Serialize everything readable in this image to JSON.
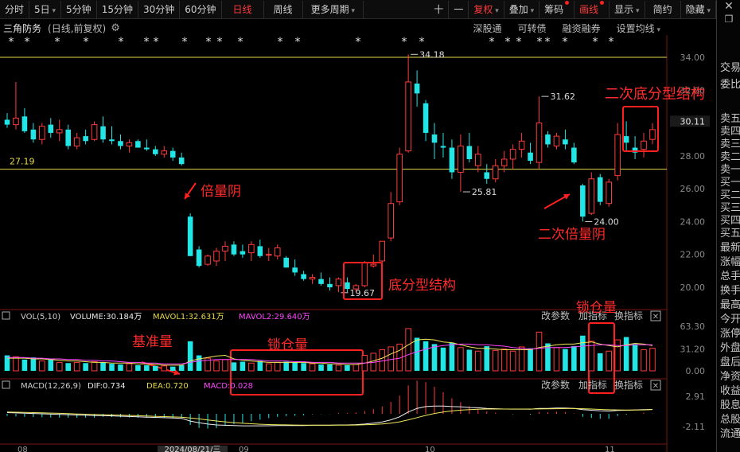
{
  "toolbar": {
    "periods": [
      "分时",
      "5日",
      "5分钟",
      "15分钟",
      "30分钟",
      "60分钟",
      "日线",
      "周线",
      "更多周期"
    ],
    "active_period": "日线",
    "right_items": [
      "十",
      "一",
      "复权",
      "叠加",
      "筹码",
      "画线",
      "显示",
      "简约",
      "隐藏"
    ]
  },
  "info": {
    "stock_name": "三角防务",
    "mode": "(日线,前复权)",
    "links": [
      "深股通",
      "可转债",
      "融资融券",
      "设置均线"
    ]
  },
  "price_axis": [
    "34.00",
    "32.00",
    "30.11",
    "28.00",
    "26.00",
    "24.00",
    "22.00",
    "20.00"
  ],
  "current_price": "30.11",
  "horizontal_lines": [
    {
      "value": 34.0,
      "color": "#e6d84a"
    },
    {
      "value": 27.19,
      "label": "27.19",
      "color": "#e6d84a"
    }
  ],
  "price_labels": [
    "34.18",
    "31.62",
    "25.81",
    "24.00",
    "19.67"
  ],
  "vol_panel": {
    "header": "VOL(5,10)",
    "volume": "VOLUME:30.184万",
    "mavol1": "MAVOL1:32.631万",
    "mavol2": "MAVOL2:29.640万",
    "axis": [
      "63.30",
      "31.20",
      "0.00"
    ],
    "buttons": [
      "改参数",
      "加指标",
      "换指标"
    ]
  },
  "macd_panel": {
    "header": "MACD(12,26,9)",
    "dif": "DIF:0.734",
    "dea": "DEA:0.720",
    "macd": "MACD:0.028",
    "axis": [
      "2.91",
      "-2.11"
    ],
    "buttons": [
      "改参数",
      "加指标",
      "换指标"
    ]
  },
  "date_axis": [
    "08",
    "2024/08/21/三",
    "09",
    "10",
    "11"
  ],
  "annotations": {
    "beiliangyin": "倍量阴",
    "difenxing": "底分型结构",
    "jizhunliang": "基准量",
    "suocangliang1": "锁仓量",
    "suocangliang2": "锁仓量",
    "erci_dif": "二次底分型结构",
    "erci_beiliang": "二次倍量阴"
  },
  "side_labels": [
    "交易",
    "委比",
    "卖五",
    "卖四",
    "卖三",
    "卖二",
    "卖一",
    "买一",
    "买二",
    "买三",
    "买四",
    "买五",
    "最新",
    "涨幅",
    "总手",
    "换手",
    "最高",
    "今开",
    "涨停",
    "外盘",
    "盘后",
    "净资",
    "收益",
    "股息",
    "总股",
    "流通"
  ],
  "chart_data": {
    "type": "candlestick",
    "ylim": [
      19.0,
      34.6
    ],
    "candles": [
      [
        30.2,
        30.6,
        29.7,
        29.9
      ],
      [
        29.9,
        32.5,
        29.6,
        30.3
      ],
      [
        30.4,
        30.9,
        29.4,
        29.5
      ],
      [
        29.6,
        30.0,
        28.8,
        29.0
      ],
      [
        29.0,
        30.0,
        28.7,
        29.8
      ],
      [
        29.9,
        30.3,
        29.1,
        29.4
      ],
      [
        29.4,
        30.2,
        28.9,
        29.6
      ],
      [
        29.6,
        29.9,
        28.4,
        28.6
      ],
      [
        28.6,
        29.4,
        28.4,
        29.1
      ],
      [
        29.2,
        29.6,
        28.7,
        28.9
      ],
      [
        29.0,
        30.1,
        28.9,
        29.9
      ],
      [
        29.8,
        30.4,
        28.8,
        29.0
      ],
      [
        29.0,
        29.8,
        28.7,
        28.9
      ],
      [
        28.9,
        29.3,
        28.4,
        28.6
      ],
      [
        28.6,
        29.0,
        28.2,
        28.8
      ],
      [
        28.9,
        29.0,
        28.5,
        28.5
      ],
      [
        28.5,
        29.0,
        28.3,
        28.4
      ],
      [
        28.4,
        28.6,
        28.0,
        28.1
      ],
      [
        28.1,
        28.6,
        27.9,
        28.3
      ],
      [
        28.3,
        28.5,
        27.7,
        27.9
      ],
      [
        27.9,
        28.2,
        27.4,
        27.5
      ],
      [
        24.3,
        24.5,
        21.9,
        21.9
      ],
      [
        22.3,
        22.5,
        21.2,
        21.3
      ],
      [
        21.4,
        22.0,
        21.3,
        21.9
      ],
      [
        21.6,
        22.4,
        21.3,
        22.2
      ],
      [
        22.2,
        22.8,
        21.6,
        22.5
      ],
      [
        22.6,
        22.8,
        21.9,
        22.0
      ],
      [
        22.2,
        22.6,
        21.8,
        22.0
      ],
      [
        22.1,
        22.8,
        21.6,
        22.6
      ],
      [
        22.5,
        22.9,
        21.8,
        21.9
      ],
      [
        22.0,
        22.4,
        21.6,
        22.0
      ],
      [
        21.9,
        22.6,
        21.7,
        22.4
      ],
      [
        21.8,
        21.9,
        21.2,
        21.2
      ],
      [
        21.2,
        21.7,
        20.7,
        20.9
      ],
      [
        20.8,
        21.0,
        20.4,
        20.5
      ],
      [
        20.5,
        20.8,
        20.2,
        20.6
      ],
      [
        20.5,
        20.9,
        20.1,
        20.2
      ],
      [
        20.2,
        20.6,
        19.8,
        20.0
      ],
      [
        20.1,
        20.6,
        19.7,
        20.5
      ],
      [
        20.3,
        20.6,
        19.7,
        19.9
      ],
      [
        19.9,
        20.2,
        19.7,
        20.1
      ],
      [
        20.1,
        21.6,
        20.0,
        21.5
      ],
      [
        21.3,
        22.0,
        21.2,
        21.4
      ],
      [
        21.6,
        22.8,
        21.4,
        22.8
      ],
      [
        23.0,
        25.8,
        22.8,
        25.1
      ],
      [
        25.2,
        28.5,
        25.0,
        28.1
      ],
      [
        28.3,
        34.18,
        28.2,
        32.5
      ],
      [
        32.4,
        33.2,
        31.0,
        31.8
      ],
      [
        31.2,
        31.4,
        28.9,
        29.4
      ],
      [
        29.3,
        30.0,
        27.8,
        28.8
      ],
      [
        28.6,
        29.4,
        27.9,
        28.5
      ],
      [
        28.5,
        29.0,
        26.6,
        27.0
      ],
      [
        27.0,
        29.3,
        25.81,
        28.6
      ],
      [
        28.6,
        29.4,
        27.6,
        27.8
      ],
      [
        27.4,
        28.6,
        27.0,
        28.1
      ],
      [
        27.0,
        27.5,
        26.3,
        26.6
      ],
      [
        26.6,
        27.8,
        26.4,
        27.4
      ],
      [
        27.4,
        28.3,
        27.0,
        27.8
      ],
      [
        27.8,
        28.7,
        27.2,
        28.4
      ],
      [
        28.4,
        29.4,
        27.9,
        28.9
      ],
      [
        28.2,
        28.8,
        27.5,
        27.7
      ],
      [
        27.6,
        31.62,
        27.2,
        30.0
      ],
      [
        29.3,
        29.5,
        28.5,
        28.7
      ],
      [
        28.6,
        29.4,
        28.4,
        29.2
      ],
      [
        29.0,
        29.6,
        28.4,
        28.7
      ],
      [
        28.5,
        28.8,
        27.5,
        27.6
      ],
      [
        26.2,
        26.3,
        24.0,
        24.3
      ],
      [
        24.5,
        27.0,
        24.4,
        26.6
      ],
      [
        26.7,
        26.9,
        25.0,
        25.2
      ],
      [
        25.1,
        26.6,
        24.9,
        26.4
      ],
      [
        26.8,
        30.0,
        26.5,
        29.3
      ],
      [
        29.2,
        30.1,
        28.3,
        28.8
      ],
      [
        28.5,
        29.2,
        27.8,
        28.2
      ],
      [
        28.4,
        29.4,
        27.9,
        28.9
      ],
      [
        29.0,
        30.0,
        28.7,
        29.6
      ]
    ],
    "volume": [
      22,
      20,
      16,
      19,
      14,
      16,
      12,
      11,
      12,
      11,
      13,
      12,
      10,
      9,
      10,
      8,
      8,
      7,
      7,
      6,
      8,
      42,
      22,
      18,
      14,
      16,
      12,
      13,
      11,
      14,
      10,
      12,
      13,
      12,
      11,
      10,
      9,
      9,
      8,
      8,
      9,
      22,
      25,
      30,
      34,
      38,
      60,
      47,
      42,
      38,
      33,
      40,
      33,
      30,
      28,
      35,
      29,
      31,
      28,
      34,
      32,
      55,
      39,
      33,
      31,
      35,
      50,
      42,
      25,
      28,
      44,
      48,
      38,
      30,
      32
    ],
    "mavol1": [
      18,
      18,
      18,
      17,
      17,
      16,
      15,
      14,
      14,
      13,
      12,
      12,
      11,
      11,
      11,
      10,
      10,
      9,
      8,
      8,
      8,
      14,
      17,
      19,
      21,
      22,
      17,
      15,
      14,
      13,
      12,
      12,
      12,
      12,
      12,
      11,
      11,
      10,
      10,
      9,
      9,
      11,
      14,
      18,
      24,
      29,
      37,
      44,
      45,
      44,
      41,
      40,
      37,
      34,
      32,
      32,
      31,
      30,
      30,
      30,
      30,
      33,
      35,
      37,
      38,
      38,
      40,
      41,
      38,
      36,
      34,
      37,
      39,
      38,
      36
    ],
    "mavol2": [
      19,
      19,
      19,
      18,
      18,
      17,
      17,
      16,
      16,
      15,
      15,
      14,
      14,
      13,
      12,
      12,
      11,
      11,
      10,
      10,
      10,
      12,
      14,
      15,
      16,
      16,
      16,
      16,
      16,
      15,
      14,
      14,
      14,
      13,
      13,
      12,
      12,
      12,
      11,
      11,
      11,
      11,
      12,
      14,
      16,
      18,
      23,
      27,
      31,
      34,
      36,
      37,
      38,
      38,
      37,
      37,
      36,
      35,
      33,
      32,
      31,
      32,
      33,
      33,
      33,
      34,
      35,
      36,
      37,
      37,
      36,
      36,
      37,
      37,
      37
    ],
    "dif": [
      0.2,
      0.15,
      0.1,
      0.05,
      0.0,
      -0.05,
      -0.1,
      -0.15,
      -0.2,
      -0.25,
      -0.3,
      -0.3,
      -0.35,
      -0.4,
      -0.45,
      -0.5,
      -0.55,
      -0.6,
      -0.65,
      -0.7,
      -0.75,
      -1.2,
      -1.5,
      -1.7,
      -1.85,
      -1.9,
      -1.95,
      -2.0,
      -2.0,
      -2.0,
      -1.98,
      -1.95,
      -1.95,
      -1.95,
      -1.95,
      -1.9,
      -1.9,
      -1.9,
      -1.85,
      -1.85,
      -1.8,
      -1.7,
      -1.55,
      -1.35,
      -1.0,
      -0.5,
      0.3,
      0.9,
      1.2,
      1.3,
      1.3,
      1.2,
      1.15,
      1.05,
      1.0,
      0.9,
      0.85,
      0.8,
      0.78,
      0.8,
      0.75,
      0.9,
      0.9,
      0.95,
      0.95,
      0.9,
      0.7,
      0.6,
      0.5,
      0.45,
      0.55,
      0.6,
      0.65,
      0.7,
      0.734
    ],
    "dea": [
      0.3,
      0.27,
      0.24,
      0.2,
      0.16,
      0.12,
      0.08,
      0.03,
      -0.02,
      -0.07,
      -0.12,
      -0.16,
      -0.2,
      -0.24,
      -0.28,
      -0.32,
      -0.37,
      -0.42,
      -0.46,
      -0.51,
      -0.56,
      -0.69,
      -0.85,
      -1.02,
      -1.19,
      -1.34,
      -1.47,
      -1.58,
      -1.66,
      -1.73,
      -1.78,
      -1.81,
      -1.84,
      -1.86,
      -1.88,
      -1.88,
      -1.89,
      -1.89,
      -1.88,
      -1.88,
      -1.86,
      -1.83,
      -1.77,
      -1.69,
      -1.55,
      -1.34,
      -1.01,
      -0.63,
      -0.26,
      0.05,
      0.3,
      0.48,
      0.61,
      0.7,
      0.76,
      0.79,
      0.8,
      0.8,
      0.8,
      0.8,
      0.79,
      0.81,
      0.83,
      0.85,
      0.87,
      0.88,
      0.84,
      0.79,
      0.73,
      0.68,
      0.65,
      0.64,
      0.64,
      0.65,
      0.72
    ]
  }
}
